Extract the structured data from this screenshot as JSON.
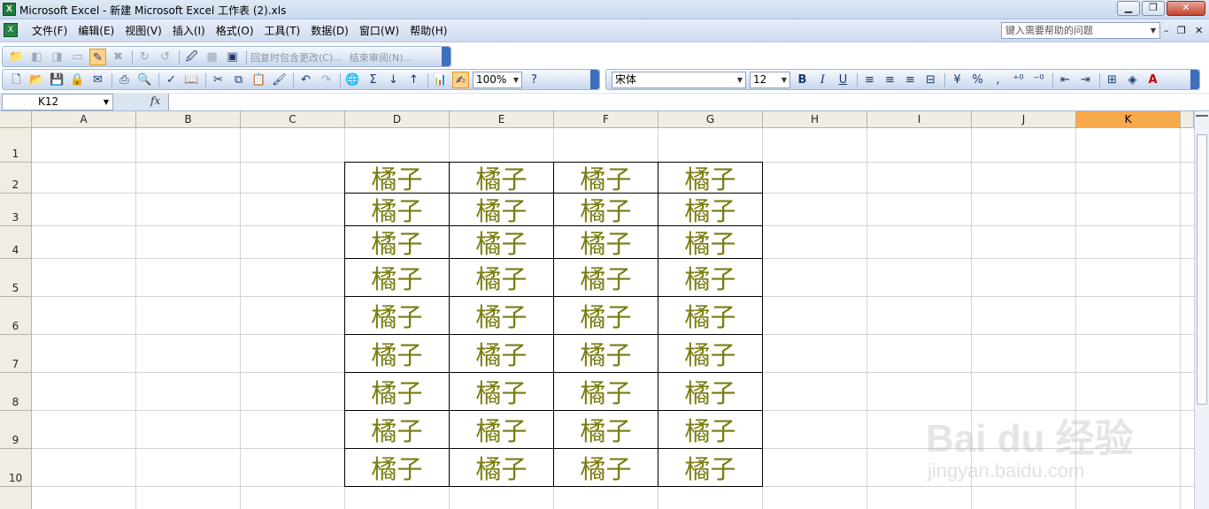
{
  "window": {
    "title": "Microsoft Excel - 新建 Microsoft Excel 工作表 (2).xls",
    "app_icon": "X"
  },
  "menu": {
    "items": [
      "文件(F)",
      "编辑(E)",
      "视图(V)",
      "插入(I)",
      "格式(O)",
      "工具(T)",
      "数据(D)",
      "窗口(W)",
      "帮助(H)"
    ],
    "help_placeholder": "键入需要帮助的问题"
  },
  "review_toolbar": {
    "reply_label": "回复时包含更改(C)...",
    "end_label": "结束审阅(N)..."
  },
  "standard_toolbar": {
    "zoom": "100%"
  },
  "format_toolbar": {
    "font": "宋体",
    "size": "12",
    "bold": "B",
    "italic": "I",
    "underline": "U",
    "percent": "%",
    "comma": ","
  },
  "formula_bar": {
    "name_box": "K12",
    "fx": "fx",
    "content": ""
  },
  "sheet": {
    "columns": [
      "A",
      "B",
      "C",
      "D",
      "E",
      "F",
      "G",
      "H",
      "I",
      "J",
      "K"
    ],
    "selected_column": "K",
    "rows": [
      "1",
      "2",
      "3",
      "4",
      "5",
      "6",
      "7",
      "8",
      "9",
      "10"
    ],
    "cell_text": "橘子",
    "filled_range": "D2:G10"
  },
  "watermark": {
    "text": "Bai du 经验",
    "sub": "jingyan.baidu.com"
  },
  "colors": {
    "cell_text": "#7a7c10",
    "selected_header": "#f8a94c",
    "toolbar_grip": "#3d6fbd"
  }
}
